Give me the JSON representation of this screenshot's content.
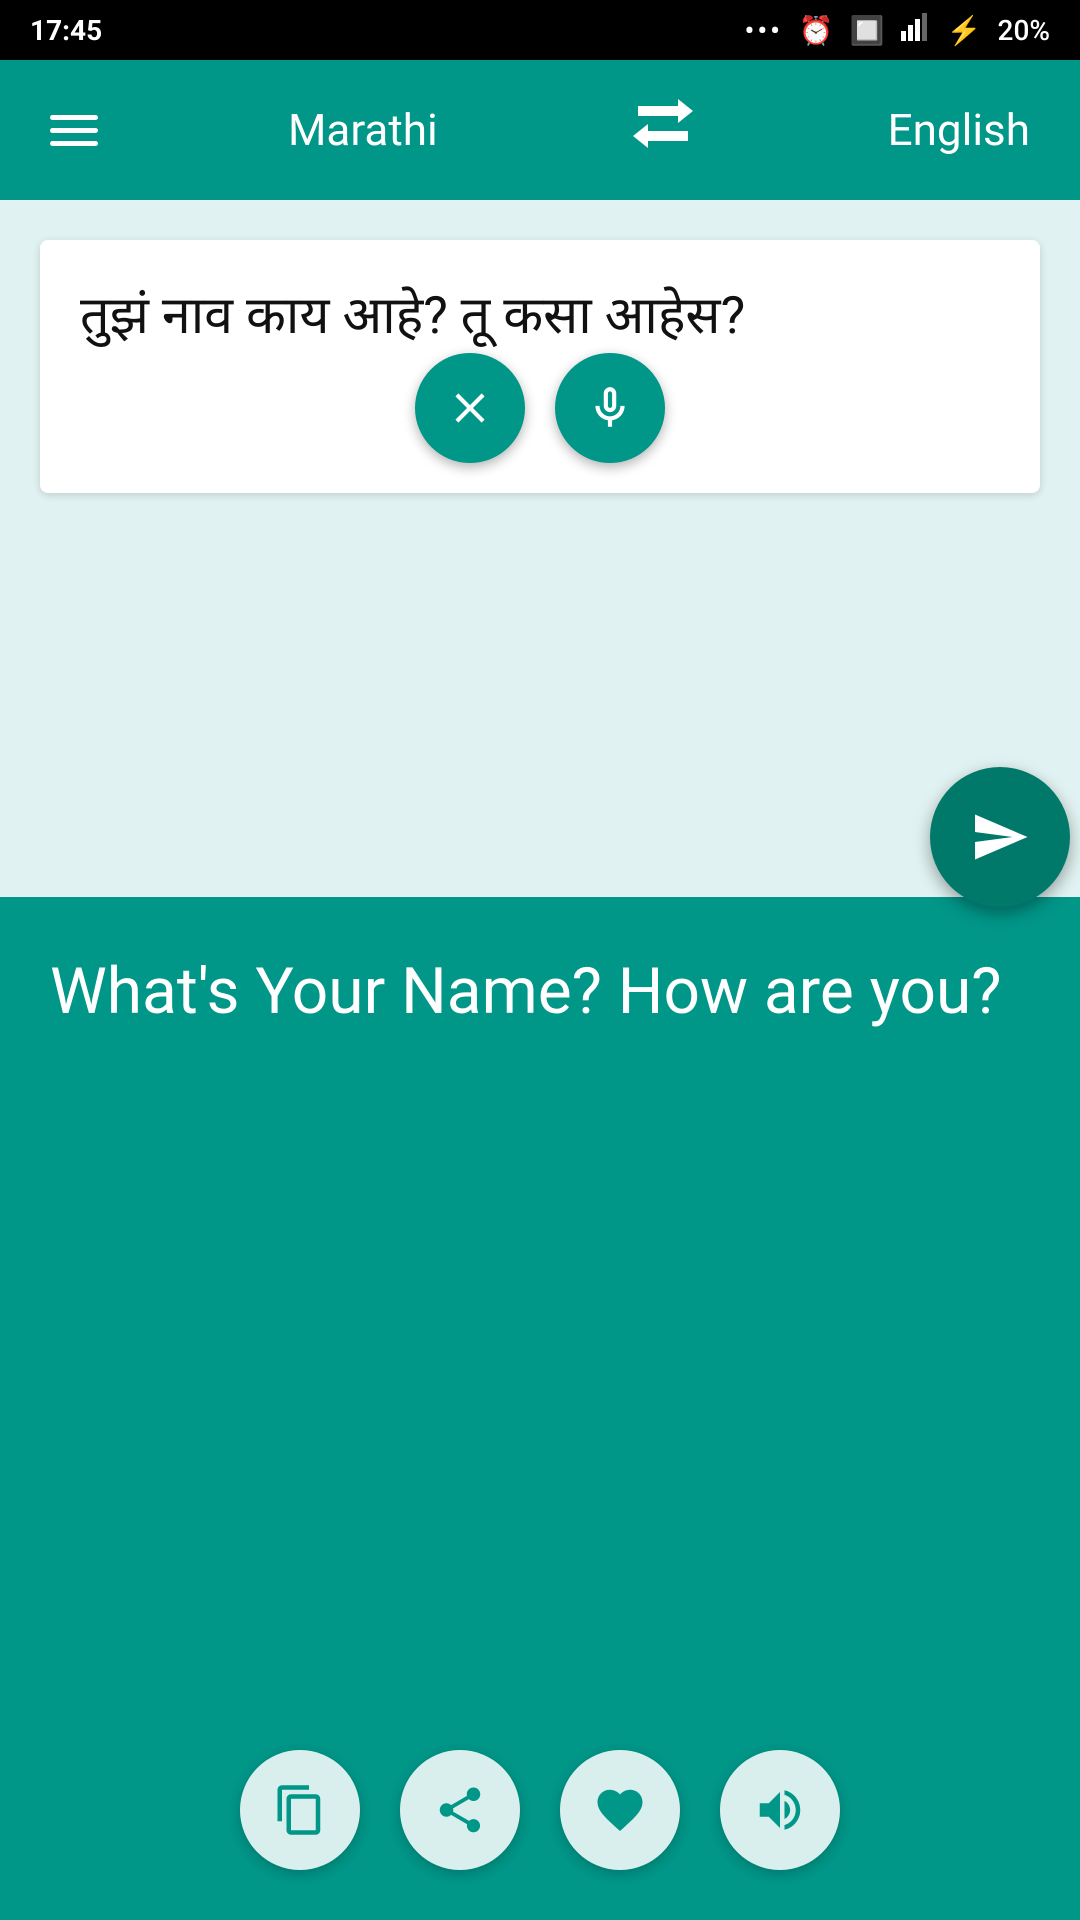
{
  "status_bar": {
    "time": "17:45",
    "battery": "20%"
  },
  "header": {
    "menu_icon": "hamburger-menu",
    "source_language": "Marathi",
    "swap_icon": "swap-icon",
    "target_language": "English"
  },
  "input_panel": {
    "text": "तुझं नाव काय आहे? तू कसा आहेस?",
    "clear_btn_label": "Clear",
    "mic_btn_label": "Microphone",
    "send_btn_label": "Send / Translate"
  },
  "output_panel": {
    "text": "What's Your Name? How are you?",
    "copy_btn_label": "Copy",
    "share_btn_label": "Share",
    "favorite_btn_label": "Favorite",
    "speaker_btn_label": "Text to Speech"
  },
  "colors": {
    "teal": "#009688",
    "dark_teal": "#00796b",
    "white": "#ffffff",
    "bg_light": "#e0f2f1"
  }
}
